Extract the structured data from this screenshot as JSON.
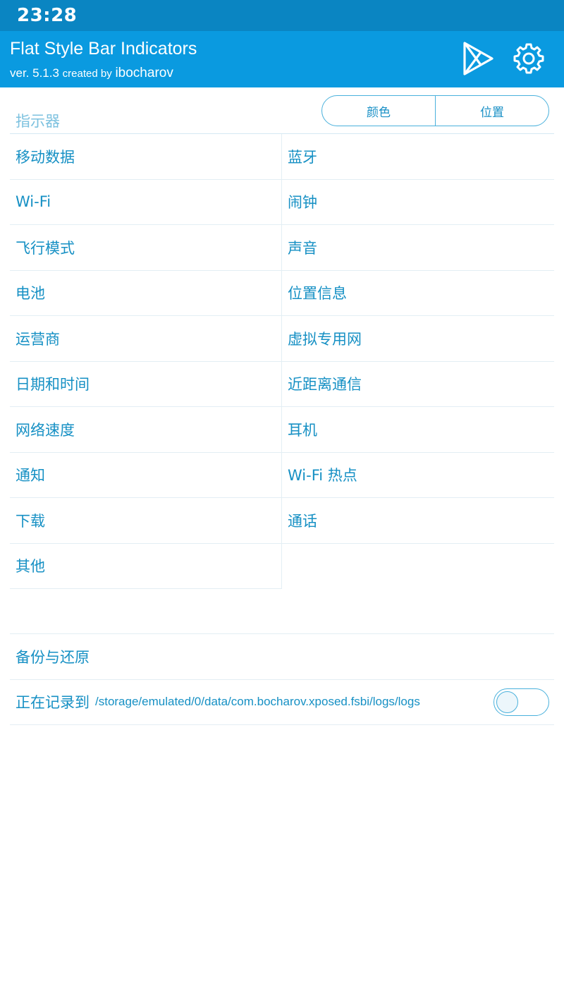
{
  "status_bar": {
    "time": "23:28"
  },
  "app_bar": {
    "title": "Flat Style Bar Indicators",
    "version": "ver. 5.1.3",
    "created_by": "created by",
    "author": "ibocharov"
  },
  "indicators": {
    "label": "指示器",
    "segments": [
      "颜色",
      "位置"
    ],
    "rows": [
      [
        "移动数据",
        "蓝牙"
      ],
      [
        "Wi-Fi",
        "闹钟"
      ],
      [
        "飞行模式",
        "声音"
      ],
      [
        "电池",
        "位置信息"
      ],
      [
        "运营商",
        "虚拟专用网"
      ],
      [
        "日期和时间",
        "近距离通信"
      ],
      [
        "网络速度",
        "耳机"
      ],
      [
        "通知",
        "Wi-Fi 热点"
      ],
      [
        "下载",
        "通话"
      ],
      [
        "其他",
        ""
      ]
    ]
  },
  "settings": {
    "backup_label": "备份与还原",
    "logging_label": "正在记录到",
    "log_path": "/storage/emulated/0/data/com.bocharov.xposed.fsbi/logs/logs",
    "logging_enabled": false
  },
  "colors": {
    "status_bar": "#0a85c2",
    "app_bar": "#0a9ae0",
    "accent_text": "#1690c4"
  }
}
